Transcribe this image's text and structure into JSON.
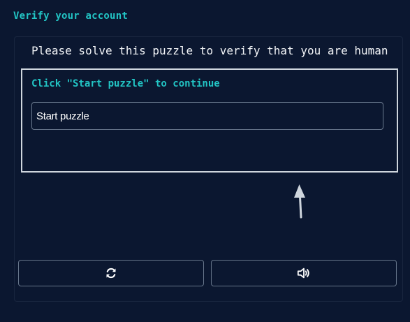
{
  "page": {
    "title": "Verify your account"
  },
  "challenge": {
    "prompt": "Please solve this puzzle to verify that you are human",
    "instruction": "Click \"Start puzzle\" to continue",
    "start_input_value": "Start puzzle"
  },
  "controls": {
    "refresh_icon": "refresh-icon",
    "audio_icon": "audio-icon"
  },
  "colors": {
    "background": "#0b1730",
    "accent": "#22c4c4",
    "frame_border": "#cfd6dd",
    "button_border": "#66758a",
    "text": "#f2f4f7"
  }
}
